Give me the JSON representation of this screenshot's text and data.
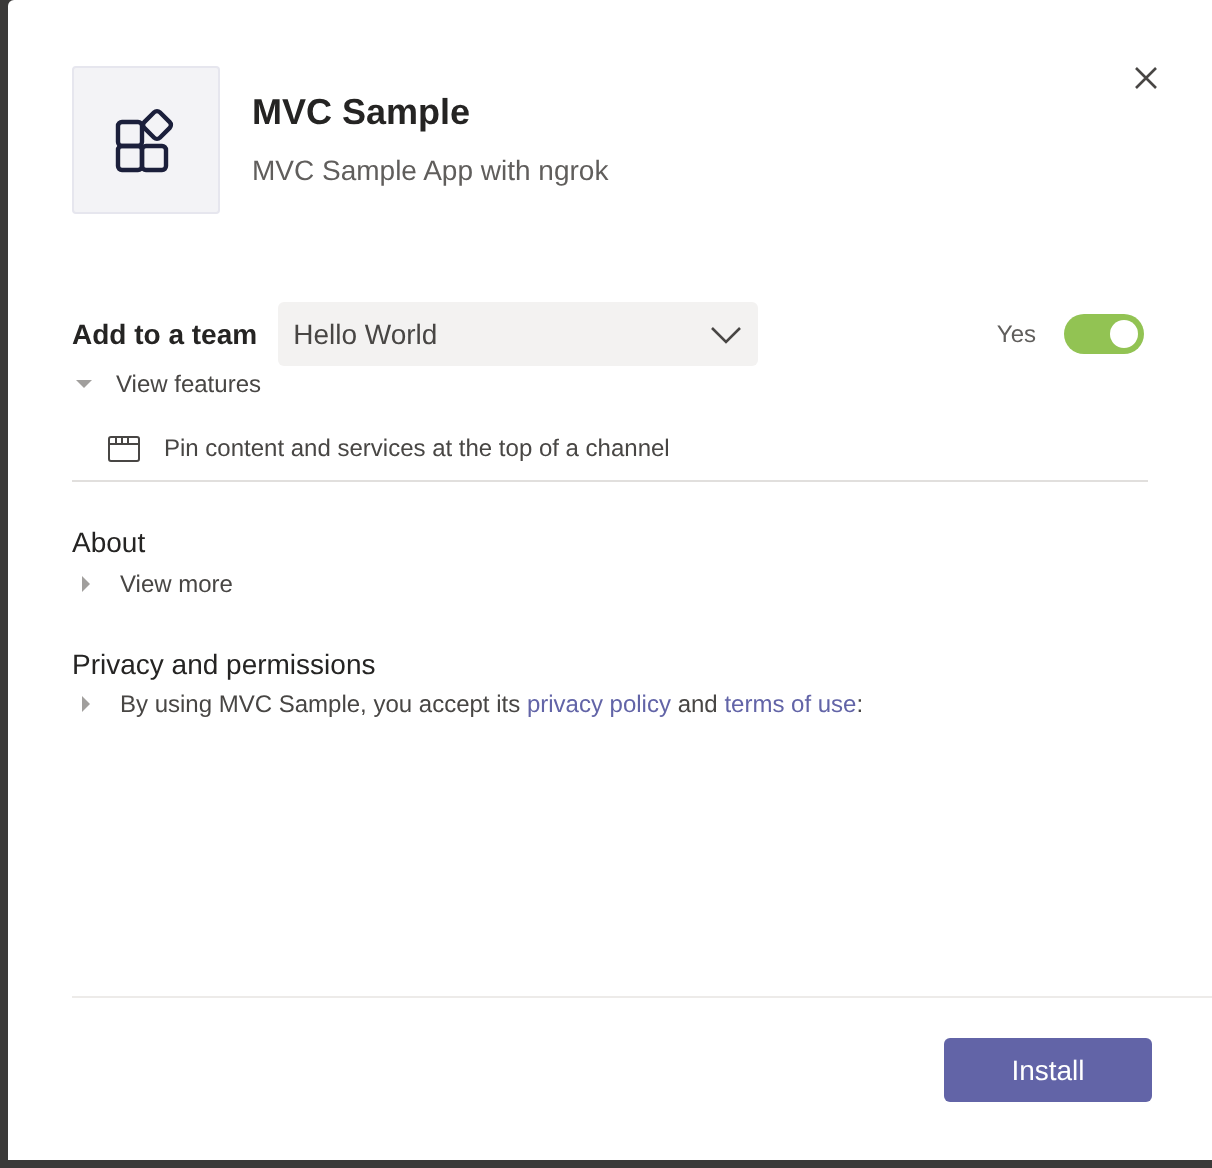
{
  "app": {
    "name": "MVC Sample",
    "description": "MVC Sample App with ngrok"
  },
  "add_to_team": {
    "label": "Add to a team",
    "team": "Hello World",
    "toggle_label": "Yes",
    "on": true
  },
  "features": {
    "label": "View features",
    "expanded": true,
    "items": [
      "Pin content and services at the top of a channel"
    ]
  },
  "about": {
    "title": "About",
    "label": "View more",
    "expanded": false
  },
  "privacy": {
    "title": "Privacy and permissions",
    "expanded": false,
    "text_before": "By using MVC Sample, you accept its",
    "privacy_link": "privacy policy",
    "text_between": "and",
    "terms_link": "terms of use",
    "text_after": ":"
  },
  "install_button": "Install"
}
